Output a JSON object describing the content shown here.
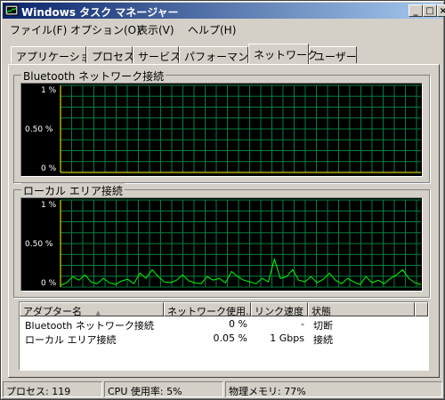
{
  "window": {
    "title": "Windows タスク マネージャー"
  },
  "title_buttons": {
    "minimize": "_",
    "maximize": "□",
    "close": "×"
  },
  "menu": [
    "ファイル(F)",
    "オプション(O)",
    "表示(V)",
    "ヘルプ(H)"
  ],
  "tabs": [
    "アプリケーション",
    "プロセス",
    "サービス",
    "パフォーマンス",
    "ネットワーク",
    "ユーザー"
  ],
  "active_tab": "ネットワーク",
  "graphs": [
    {
      "label": "Bluetooth ネットワーク接続",
      "y_ticks": [
        "1 %",
        "0.50 %",
        "0 %"
      ],
      "chart_data": {
        "type": "line",
        "ylim": [
          0,
          1
        ],
        "unit": "%",
        "values": [
          0,
          0,
          0,
          0,
          0,
          0,
          0,
          0,
          0,
          0,
          0,
          0,
          0,
          0,
          0,
          0,
          0,
          0,
          0,
          0,
          0,
          0,
          0,
          0,
          0,
          0,
          0,
          0,
          0,
          0,
          0,
          0,
          0,
          0,
          0,
          0,
          0,
          0,
          0,
          0,
          0,
          0,
          0,
          0,
          0,
          0,
          0,
          0,
          0,
          0,
          0,
          0,
          0,
          0,
          0,
          0,
          0,
          0,
          0,
          0
        ],
        "grid": true,
        "color": "#ffff00"
      }
    },
    {
      "label": "ローカル エリア接続",
      "y_ticks": [
        "1 %",
        "0.50 %",
        "0 %"
      ],
      "chart_data": {
        "type": "line",
        "ylim": [
          0,
          1
        ],
        "unit": "%",
        "values": [
          0.02,
          0.05,
          0.12,
          0.08,
          0.14,
          0.06,
          0.04,
          0.1,
          0.05,
          0.03,
          0.07,
          0.09,
          0.04,
          0.16,
          0.1,
          0.2,
          0.12,
          0.06,
          0.05,
          0.08,
          0.14,
          0.07,
          0.05,
          0.04,
          0.12,
          0.08,
          0.1,
          0.05,
          0.18,
          0.12,
          0.08,
          0.06,
          0.04,
          0.1,
          0.06,
          0.32,
          0.1,
          0.12,
          0.2,
          0.08,
          0.06,
          0.12,
          0.05,
          0.09,
          0.16,
          0.08,
          0.04,
          0.1,
          0.06,
          0.03,
          0.12,
          0.05,
          0.08,
          0.04,
          0.1,
          0.14,
          0.2,
          0.1,
          0.05,
          0.03
        ],
        "grid": true,
        "color": "#00ff00"
      }
    }
  ],
  "table": {
    "columns": [
      "アダプター名",
      "ネットワーク使用...",
      "リンク速度",
      "状態"
    ],
    "sort_indicator": "▲",
    "rows": [
      [
        "Bluetooth ネットワーク接続",
        "0 %",
        "-",
        "切断"
      ],
      [
        "ローカル エリア接続",
        "0.05 %",
        "1 Gbps",
        "接続"
      ]
    ]
  },
  "status": {
    "processes": "プロセス: 119",
    "cpu": "CPU 使用率: 5%",
    "memory": "物理メモリ: 77%"
  }
}
